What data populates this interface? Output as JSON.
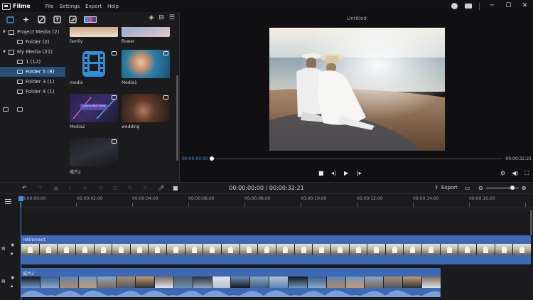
{
  "titlebar": {
    "app_name": "Filme",
    "menu": [
      "File",
      "Settings",
      "Export",
      "Help"
    ],
    "minimize": "─",
    "maximize": "☐",
    "close": "✕"
  },
  "media_toolbar": {
    "icons": [
      "media-icon",
      "effects-icon",
      "filter-icon",
      "text-icon",
      "transition-icon",
      "template-icon"
    ],
    "right_icons": [
      "layers-icon",
      "grid-view-icon",
      "sort-icon"
    ]
  },
  "tree": {
    "items": [
      {
        "label": "Project Media (2)",
        "level": 0,
        "expanded": true
      },
      {
        "label": "Folder (2)",
        "level": 1
      },
      {
        "label": "My Media (21)",
        "level": 0,
        "expanded": true
      },
      {
        "label": "1 (12)",
        "level": 1
      },
      {
        "label": "Folder 5 (8)",
        "level": 1,
        "selected": true
      },
      {
        "label": "Folder 3 (1)",
        "level": 1
      },
      {
        "label": "Folder 4 (1)",
        "level": 1
      }
    ]
  },
  "media": {
    "items": [
      {
        "name": "family"
      },
      {
        "name": "flower"
      },
      {
        "name": "media"
      },
      {
        "name": "Media1"
      },
      {
        "name": "Media2"
      },
      {
        "name": "wedding"
      },
      {
        "name": "威片2"
      }
    ],
    "media2_overlay_text": "Cinema Rest Video"
  },
  "preview": {
    "title": "Untitled",
    "current_time": "00:00:00:00",
    "total_time": "00:00:32:21",
    "progress": 0
  },
  "timeline_toolbar": {
    "timecode": "00:00:00:00 / 00:00:32:21",
    "export_label": "Export",
    "zoom_level": 0.75
  },
  "ruler": {
    "labels": [
      "00:00:00:00",
      "00:00:02:00",
      "00:00:04:00",
      "00:00:06:00",
      "00:00:08:00",
      "00:00:10:00",
      "00:00:12:00",
      "00:00:14:00",
      "00:00:16:00"
    ]
  },
  "tracks": [
    {
      "clip_name": "retirement"
    },
    {
      "clip_name": "威片2"
    }
  ],
  "colors": {
    "accent": "#3a8ee6",
    "clip": "#3d68b3",
    "selection": "#264f78"
  }
}
